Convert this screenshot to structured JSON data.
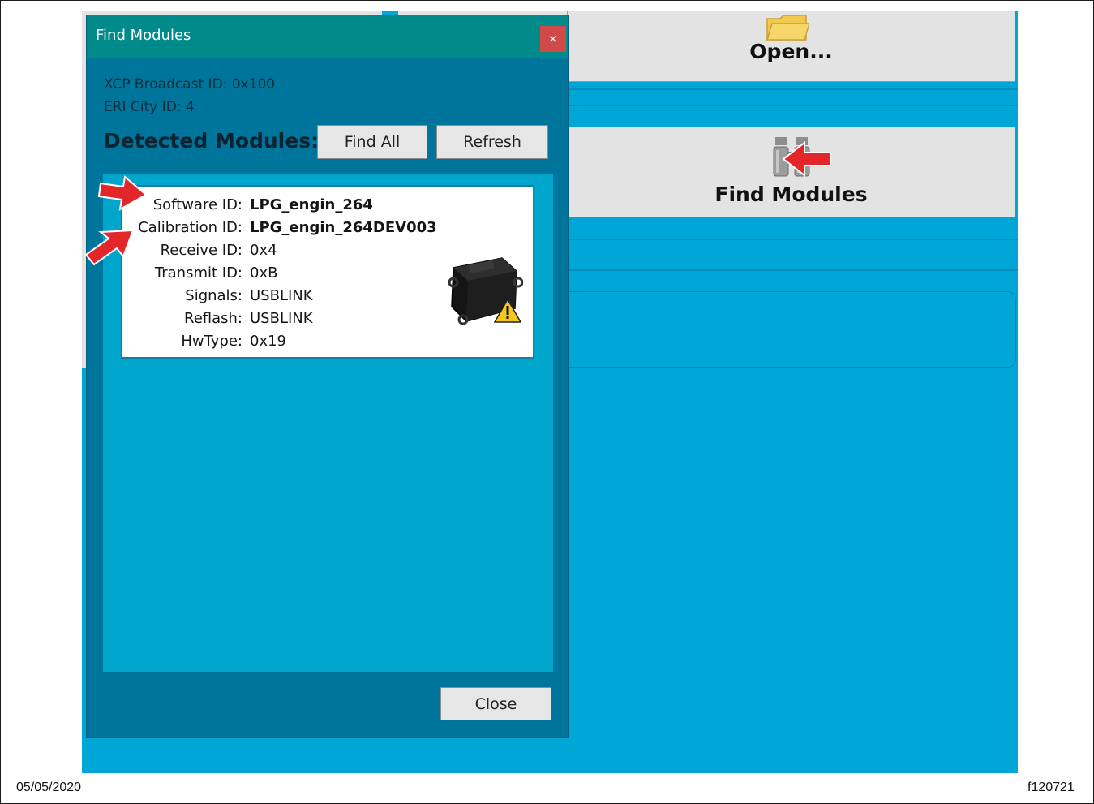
{
  "background": {
    "open_label": "Open...",
    "find_modules_label": "Find Modules"
  },
  "dialog": {
    "title": "Find Modules",
    "close_x": "×",
    "xcp_broadcast": "XCP Broadcast ID:  0x100",
    "eri_city": "ERI City ID: 4",
    "detected_heading": "Detected Modules:",
    "find_all_label": "Find All",
    "refresh_label": "Refresh",
    "close_label": "Close",
    "module": {
      "rows": [
        {
          "key": "Software ID:",
          "value": "LPG_engin_264",
          "bold": true
        },
        {
          "key": "Calibration ID:",
          "value": "LPG_engin_264DEV003",
          "bold": true
        },
        {
          "key": "Receive ID:",
          "value": "0x4",
          "bold": false
        },
        {
          "key": "Transmit ID:",
          "value": "0xB",
          "bold": false
        },
        {
          "key": "Signals:",
          "value": "USBLINK",
          "bold": false
        },
        {
          "key": "Reflash:",
          "value": "USBLINK",
          "bold": false
        },
        {
          "key": "HwType:",
          "value": "0x19",
          "bold": false
        }
      ]
    }
  },
  "footer": {
    "date": "05/05/2020",
    "figure_id": "f120721"
  },
  "colors": {
    "app_background": "#00a7d6",
    "dialog_body": "#00759b",
    "dialog_titlebar": "#008a89",
    "close_x_bg": "#d04a4a",
    "annotation_arrow": "#e3262a"
  },
  "icons": [
    "folder-icon",
    "binoculars-icon",
    "ecu-module-icon",
    "warning-icon",
    "annotation-arrow"
  ]
}
